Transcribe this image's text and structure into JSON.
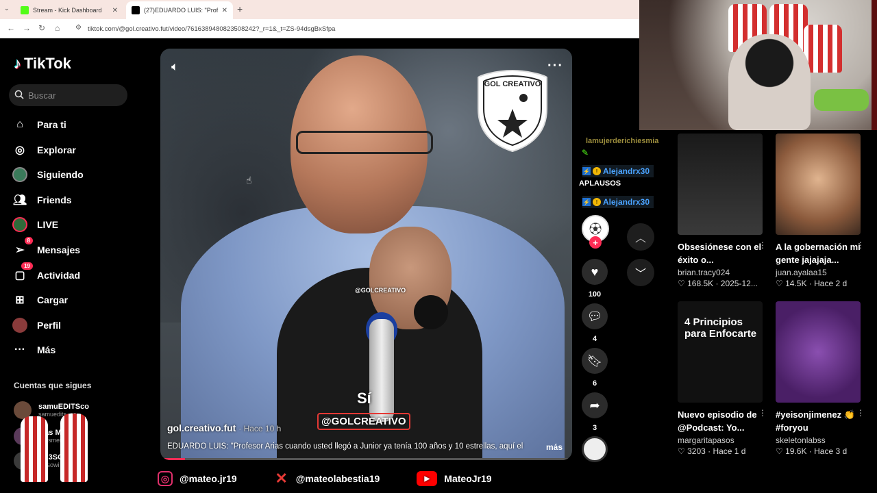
{
  "browser": {
    "tabs": [
      {
        "title": "Stream - Kick Dashboard",
        "favicon_color": "#53fc18"
      },
      {
        "title": "(27)EDUARDO LUIS: \"Profesor A",
        "favicon_color": "#000000"
      }
    ],
    "new_tab": "+",
    "url": "tiktok.com/@gol.creativo.fut/video/7616389480823508242?_r=1&_t=ZS-94dsgBxSfpa"
  },
  "tiktok": {
    "logo": "TikTok",
    "search_placeholder": "Buscar",
    "nav": [
      {
        "label": "Para ti",
        "icon": "home-icon",
        "badge": ""
      },
      {
        "label": "Explorar",
        "icon": "compass-icon",
        "badge": ""
      },
      {
        "label": "Siguiendo",
        "icon": "following-avatar-icon",
        "badge": ""
      },
      {
        "label": "Friends",
        "icon": "friends-icon",
        "badge": ""
      },
      {
        "label": "LIVE",
        "icon": "live-icon",
        "badge": ""
      },
      {
        "label": "Mensajes",
        "icon": "messages-icon",
        "badge": "8"
      },
      {
        "label": "Actividad",
        "icon": "activity-icon",
        "badge": "19"
      },
      {
        "label": "Cargar",
        "icon": "upload-icon",
        "badge": ""
      },
      {
        "label": "Perfil",
        "icon": "profile-icon",
        "badge": ""
      },
      {
        "label": "Más",
        "icon": "more-icon",
        "badge": ""
      }
    ],
    "following_title": "Cuentas que sigues",
    "following": [
      {
        "name": "samuEDITSco",
        "handle": "samuedits_co"
      },
      {
        "name": "Ilias M",
        "handle": "eliasmeri7"
      },
      {
        "name": "TH3SOW",
        "handle": "th3sowi"
      }
    ]
  },
  "video": {
    "author": "gol.creativo.fut",
    "time": "· Hace 10 h",
    "description": "EDUARDO LUIS: \"Profesor Arias cuando usted llegó a Junior ya tenía 100 años y 10 estrellas, aquí el",
    "more_label": "más",
    "watermark_small": "@GOLCREATIVO",
    "subtitle": "Sí",
    "watermark_big": "@GOLCREATIVO",
    "emblem_text": "GOL CREATIVO",
    "progress": 0.06
  },
  "actions": {
    "likes": "100",
    "comments": "4",
    "saves": "6",
    "shares": "3"
  },
  "chat": {
    "top_user": "lamujerderichiesmia",
    "users": [
      "Alejandrx30",
      "Alejandrx30"
    ],
    "message": "APLAUSOS"
  },
  "feed": [
    {
      "title": "Obsesiónese con el éxito o...",
      "user": "brian.tracy024",
      "stats": "♡ 168.5K · 2025-12...",
      "thumb": "#2a2a2a"
    },
    {
      "title": "A la gobernación mi gente jajajaja...",
      "user": "juan.ayalaa15",
      "stats": "♡ 14.5K · Hace 2 d",
      "thumb": "#c99b76"
    },
    {
      "title": "Nuevo episodio de @Podcast: Yo...",
      "user": "margaritapasos",
      "stats": "♡ 3203 · Hace 1 d",
      "thumb": "#111111",
      "thumb_text": "4 Principios para Enfocarte"
    },
    {
      "title": "#yeisonjimenez 👏 #foryou",
      "user": "skeletonlabss",
      "stats": "♡ 19.6K · Hace 3 d",
      "thumb": "#6a2c8a"
    }
  ],
  "social": [
    {
      "handle": "@mateo.jr19",
      "icon": "instagram-icon",
      "color": "#e1306c"
    },
    {
      "handle": "@mateolabestia19",
      "icon": "x-icon",
      "color": "#e53935"
    },
    {
      "handle": "MateoJr19",
      "icon": "youtube-icon",
      "color": "#ff0000"
    }
  ]
}
